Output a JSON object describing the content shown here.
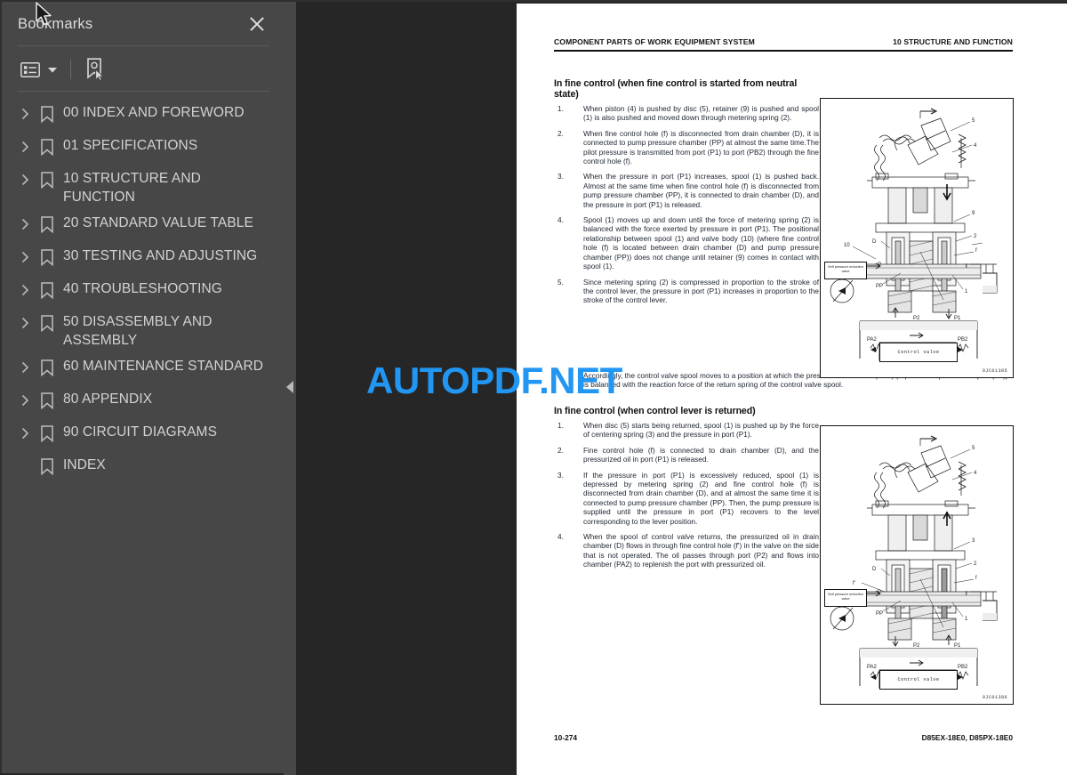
{
  "panel": {
    "title": "Bookmarks",
    "close_icon": "close-icon",
    "toolbar": {
      "options_icon": "list-options-icon",
      "options_caret_icon": "chevron-down-icon",
      "find_bookmark_icon": "find-current-bookmark-icon"
    },
    "items": [
      {
        "label": "00 INDEX AND FOREWORD",
        "expandable": true
      },
      {
        "label": "01 SPECIFICATIONS",
        "expandable": true
      },
      {
        "label": "10 STRUCTURE AND FUNCTION",
        "expandable": true
      },
      {
        "label": "20 STANDARD VALUE TABLE",
        "expandable": true
      },
      {
        "label": "30 TESTING AND ADJUSTING",
        "expandable": true
      },
      {
        "label": "40 TROUBLESHOOTING",
        "expandable": true
      },
      {
        "label": "50 DISASSEMBLY AND ASSEMBLY",
        "expandable": true
      },
      {
        "label": "60 MAINTENANCE STANDARD",
        "expandable": true
      },
      {
        "label": "80 APPENDIX",
        "expandable": true
      },
      {
        "label": "90 CIRCUIT DIAGRAMS",
        "expandable": true
      },
      {
        "label": "INDEX",
        "expandable": false
      }
    ]
  },
  "divider": {
    "collapse_icon": "collapse-left-icon"
  },
  "watermark": {
    "text": "AUTOPDF.NET",
    "color": "#2196f3"
  },
  "page": {
    "header": {
      "left": "COMPONENT PARTS OF WORK EQUIPMENT SYSTEM",
      "right": "10 STRUCTURE AND FUNCTION"
    },
    "section1": {
      "title": "In fine control (when fine control is started from neutral state)",
      "steps": [
        {
          "num": "1.",
          "text": "When piston (4) is pushed by disc (5), retainer (9) is pushed and spool (1) is also pushed and moved down through metering spring (2)."
        },
        {
          "num": "2.",
          "text": "When fine control hole (f) is disconnected from drain chamber (D), it is connected to pump pressure chamber (PP) at almost the same time.The pilot pressure is transmitted from port (P1) to port (PB2) through the fine control hole (f)."
        },
        {
          "num": "3.",
          "text": "When the pressure in port (P1) increases, spool (1) is pushed back. Almost at the same time when fine control hole (f) is disconnected from pump pressure chamber (PP), it is connected to drain chamber (D), and the pressure in port (P1) is released."
        },
        {
          "num": "4.",
          "text": "Spool (1) moves up and down until the force of metering spring (2) is balanced with the force exerted by pressure in port (P1). The positional relationship between spool (1) and valve body (10) (where fine control hole (f) is located between drain chamber (D) and pump pressure chamber (PP)) does not change until retainer (9) comes in contact with spool (1)."
        },
        {
          "num": "5.",
          "text": "Since metering spring (2) is compressed in proportion to the stroke of the control lever, the pressure in port (P1) increases in proportion to the stroke of the control lever."
        }
      ],
      "wide_note": {
        "num": "6.",
        "text": "Accordingly, the control valve spool moves to a position at which the pressure in chamber (PB2) (equal to the pressure in port (P1)) is balanced with the reaction force of the return spring of the control valve spool."
      }
    },
    "section2": {
      "title": "In fine control (when control lever is returned)",
      "steps": [
        {
          "num": "1.",
          "text": "When disc (5) starts being returned, spool (1) is pushed up by the force of centering spring (3) and the pressure in port (P1)."
        },
        {
          "num": "2.",
          "text": "Fine control hole (f) is connected to drain chamber (D), and the pressurized oil in port (P1) is released."
        },
        {
          "num": "3.",
          "text": "If the pressure in port (P1) is excessively reduced, spool (1) is depressed by metering spring (2) and fine control hole (f) is disconnected from drain chamber (D), and at almost the same time it is connected to pump pressure chamber (PP). Then, the pump pressure is supplied until the pressure in port (P1) recovers to the level corresponding to the lever position."
        },
        {
          "num": "4.",
          "text": "When the spool of control valve returns, the pressurized oil in drain chamber (D) flows in through fine control hole (f') in the valve on the side that is not operated. The oil passes through port (P2) and flows into chamber (PA2) to replenish the port with pressurized oil."
        }
      ]
    },
    "diagram1": {
      "id": "9JC01385",
      "self_valve_label": "Self pressure reduction valve",
      "control_valve_label": "Control valve",
      "labels": [
        "5",
        "4",
        "9",
        "2",
        "f",
        "10",
        "D",
        "P",
        "T",
        "PP",
        "1",
        "P2",
        "P1",
        "PA2",
        "PB2"
      ]
    },
    "diagram2": {
      "id": "9JC01386",
      "self_valve_label": "Self pressure reduction valve",
      "control_valve_label": "Control valve",
      "labels": [
        "5",
        "4",
        "3",
        "2",
        "f'",
        "D",
        "P",
        "T",
        "PP",
        "1",
        "P2",
        "P1",
        "PA2",
        "PB2"
      ]
    },
    "footer": {
      "left": "10-274",
      "right": "D85EX-18E0, D85PX-18E0"
    }
  }
}
